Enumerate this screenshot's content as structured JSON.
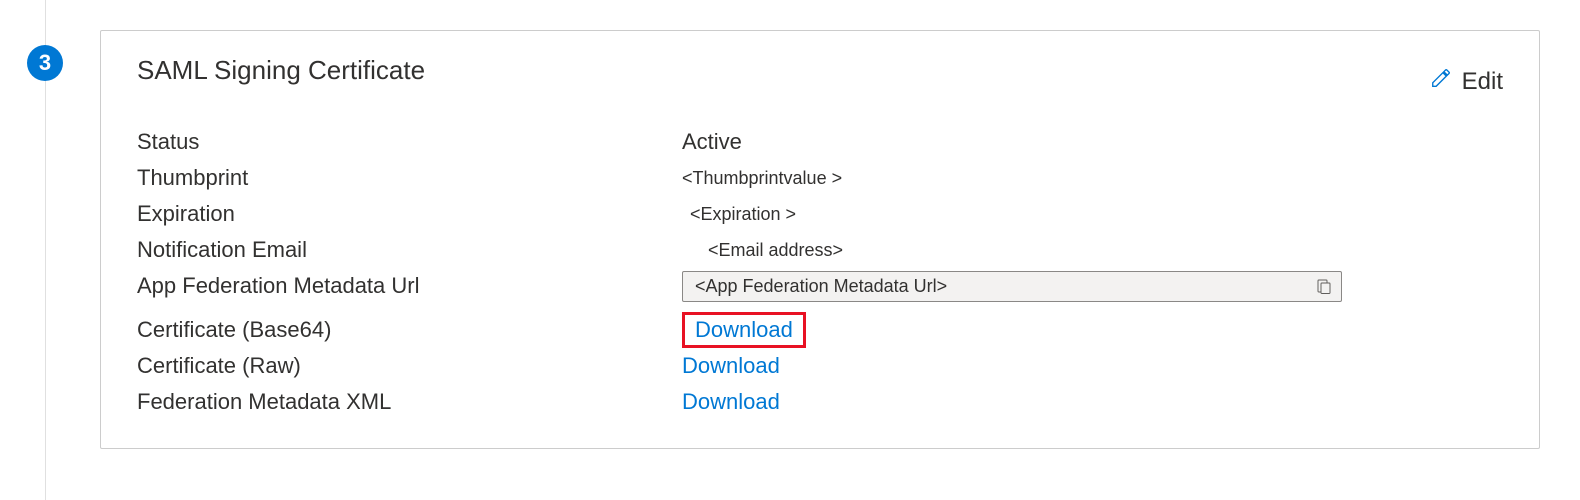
{
  "step": {
    "number": "3"
  },
  "card": {
    "title": "SAML Signing Certificate",
    "edit_label": "Edit"
  },
  "fields": {
    "status": {
      "label": "Status",
      "value": "Active"
    },
    "thumbprint": {
      "label": "Thumbprint",
      "value": "<Thumbprintvalue >"
    },
    "expiration": {
      "label": "Expiration",
      "value": "<Expiration >"
    },
    "notification_email": {
      "label": "Notification Email",
      "value": "<Email address>"
    },
    "metadata_url": {
      "label": "App Federation Metadata Url",
      "value": "<App Federation  Metadata Url>"
    },
    "cert_base64": {
      "label": "Certificate (Base64)",
      "link": "Download"
    },
    "cert_raw": {
      "label": "Certificate (Raw)",
      "link": "Download"
    },
    "metadata_xml": {
      "label": "Federation Metadata XML",
      "link": "Download"
    }
  }
}
